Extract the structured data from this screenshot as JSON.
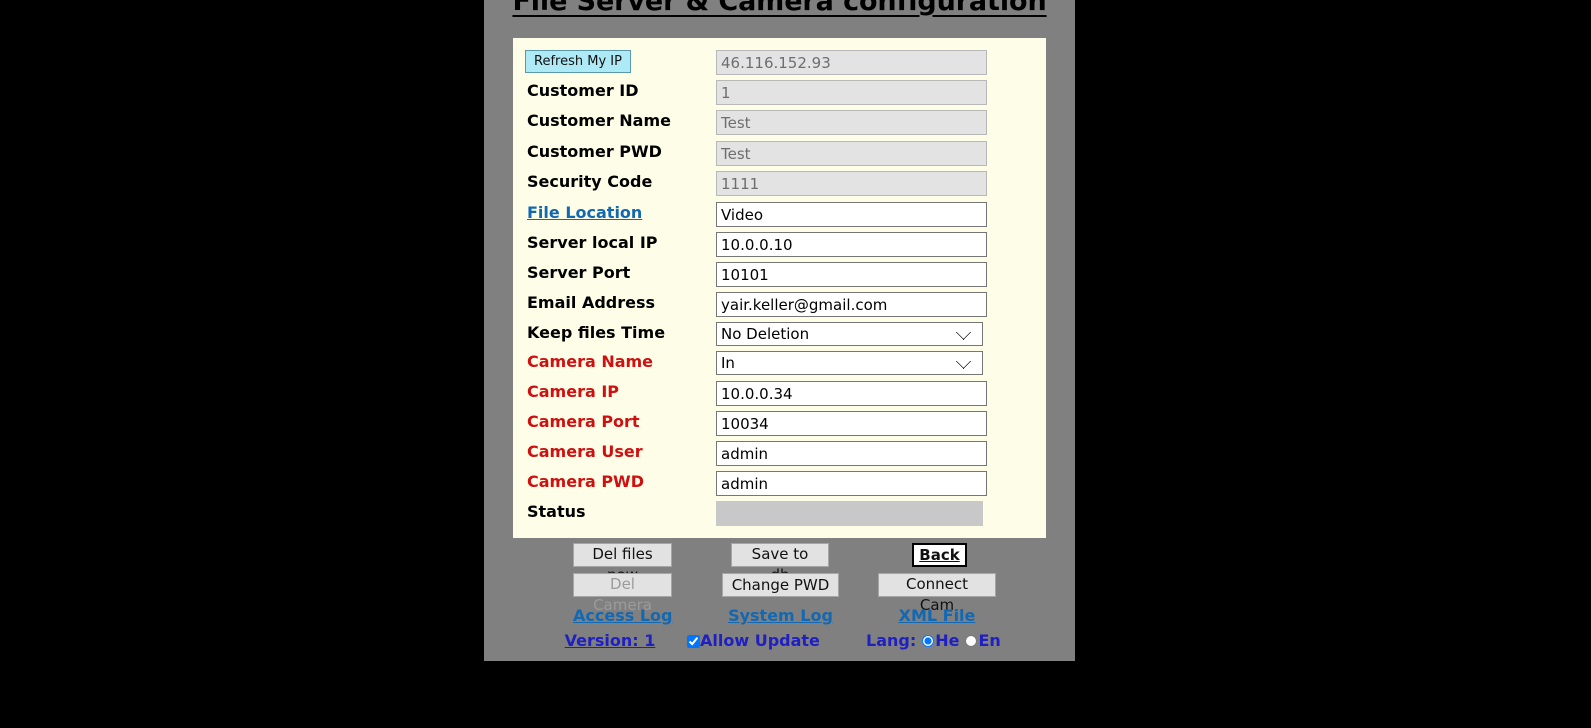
{
  "page": {
    "title": "File Server & Camera configuration"
  },
  "form": {
    "refresh_ip_button": "Refresh My IP",
    "rows": [
      {
        "label": "",
        "value": "46.116.152.93",
        "kind": "text",
        "disabled": true
      },
      {
        "label": "Customer ID",
        "value": "1",
        "kind": "text",
        "disabled": true
      },
      {
        "label": "Customer Name",
        "value": "Test",
        "kind": "text",
        "disabled": true
      },
      {
        "label": "Customer PWD",
        "value": "Test",
        "kind": "text",
        "disabled": true
      },
      {
        "label": "Security Code",
        "value": "1111",
        "kind": "text",
        "disabled": true
      },
      {
        "label": "File Location",
        "value": "Video",
        "kind": "text",
        "disabled": false
      },
      {
        "label": "Server local IP",
        "value": "10.0.0.10",
        "kind": "text",
        "disabled": false
      },
      {
        "label": "Server Port",
        "value": "10101",
        "kind": "text",
        "disabled": false
      },
      {
        "label": "Email Address",
        "value": "yair.keller@gmail.com",
        "kind": "text",
        "disabled": false
      },
      {
        "label": "Keep files Time",
        "value": "No Deletion",
        "kind": "select",
        "disabled": false
      },
      {
        "label": "Camera Name",
        "value": "In",
        "kind": "select",
        "disabled": false
      },
      {
        "label": "Camera IP",
        "value": "10.0.0.34",
        "kind": "text",
        "disabled": false
      },
      {
        "label": "Camera Port",
        "value": "10034",
        "kind": "text",
        "disabled": false
      },
      {
        "label": "Camera User",
        "value": "admin",
        "kind": "text",
        "disabled": false
      },
      {
        "label": "Camera PWD",
        "value": "admin",
        "kind": "text",
        "disabled": false
      },
      {
        "label": "Status",
        "value": "",
        "kind": "status",
        "disabled": true
      }
    ],
    "label_file_location": "File Location",
    "label_customer_id": "Customer ID",
    "label_customer_name": "Customer Name",
    "label_customer_pwd": "Customer PWD",
    "label_security_code": "Security Code",
    "label_server_local_ip": "Server local IP",
    "label_server_port": "Server Port",
    "label_email_address": "Email Address",
    "label_keep_files_time": "Keep files Time",
    "label_camera_name": "Camera Name",
    "label_camera_ip": "Camera IP",
    "label_camera_port": "Camera Port",
    "label_camera_user": "Camera User",
    "label_camera_pwd": "Camera PWD",
    "label_status": "Status"
  },
  "buttons": {
    "del_files_now": "Del files now",
    "save_to_db": "Save to db",
    "back": "Back",
    "del_camera": "Del Camera",
    "change_pwd": "Change PWD",
    "connect_cam": "Connect Cam"
  },
  "footer": {
    "access_log": "Access Log",
    "system_log": "System Log",
    "xml_file": "XML File",
    "version": "Version: 1",
    "allow_update": "Allow Update",
    "allow_update_checked": true,
    "lang_label": "Lang:",
    "lang_he": "He",
    "lang_en": "En",
    "lang_selected": "He"
  },
  "colors": {
    "page_bg": "#808080",
    "panel_bg": "#fefee8",
    "label_red": "#d01010",
    "link_blue": "#1268b3",
    "footer_violet": "#2020c0",
    "refresh_btn": "#aeeaf5"
  }
}
